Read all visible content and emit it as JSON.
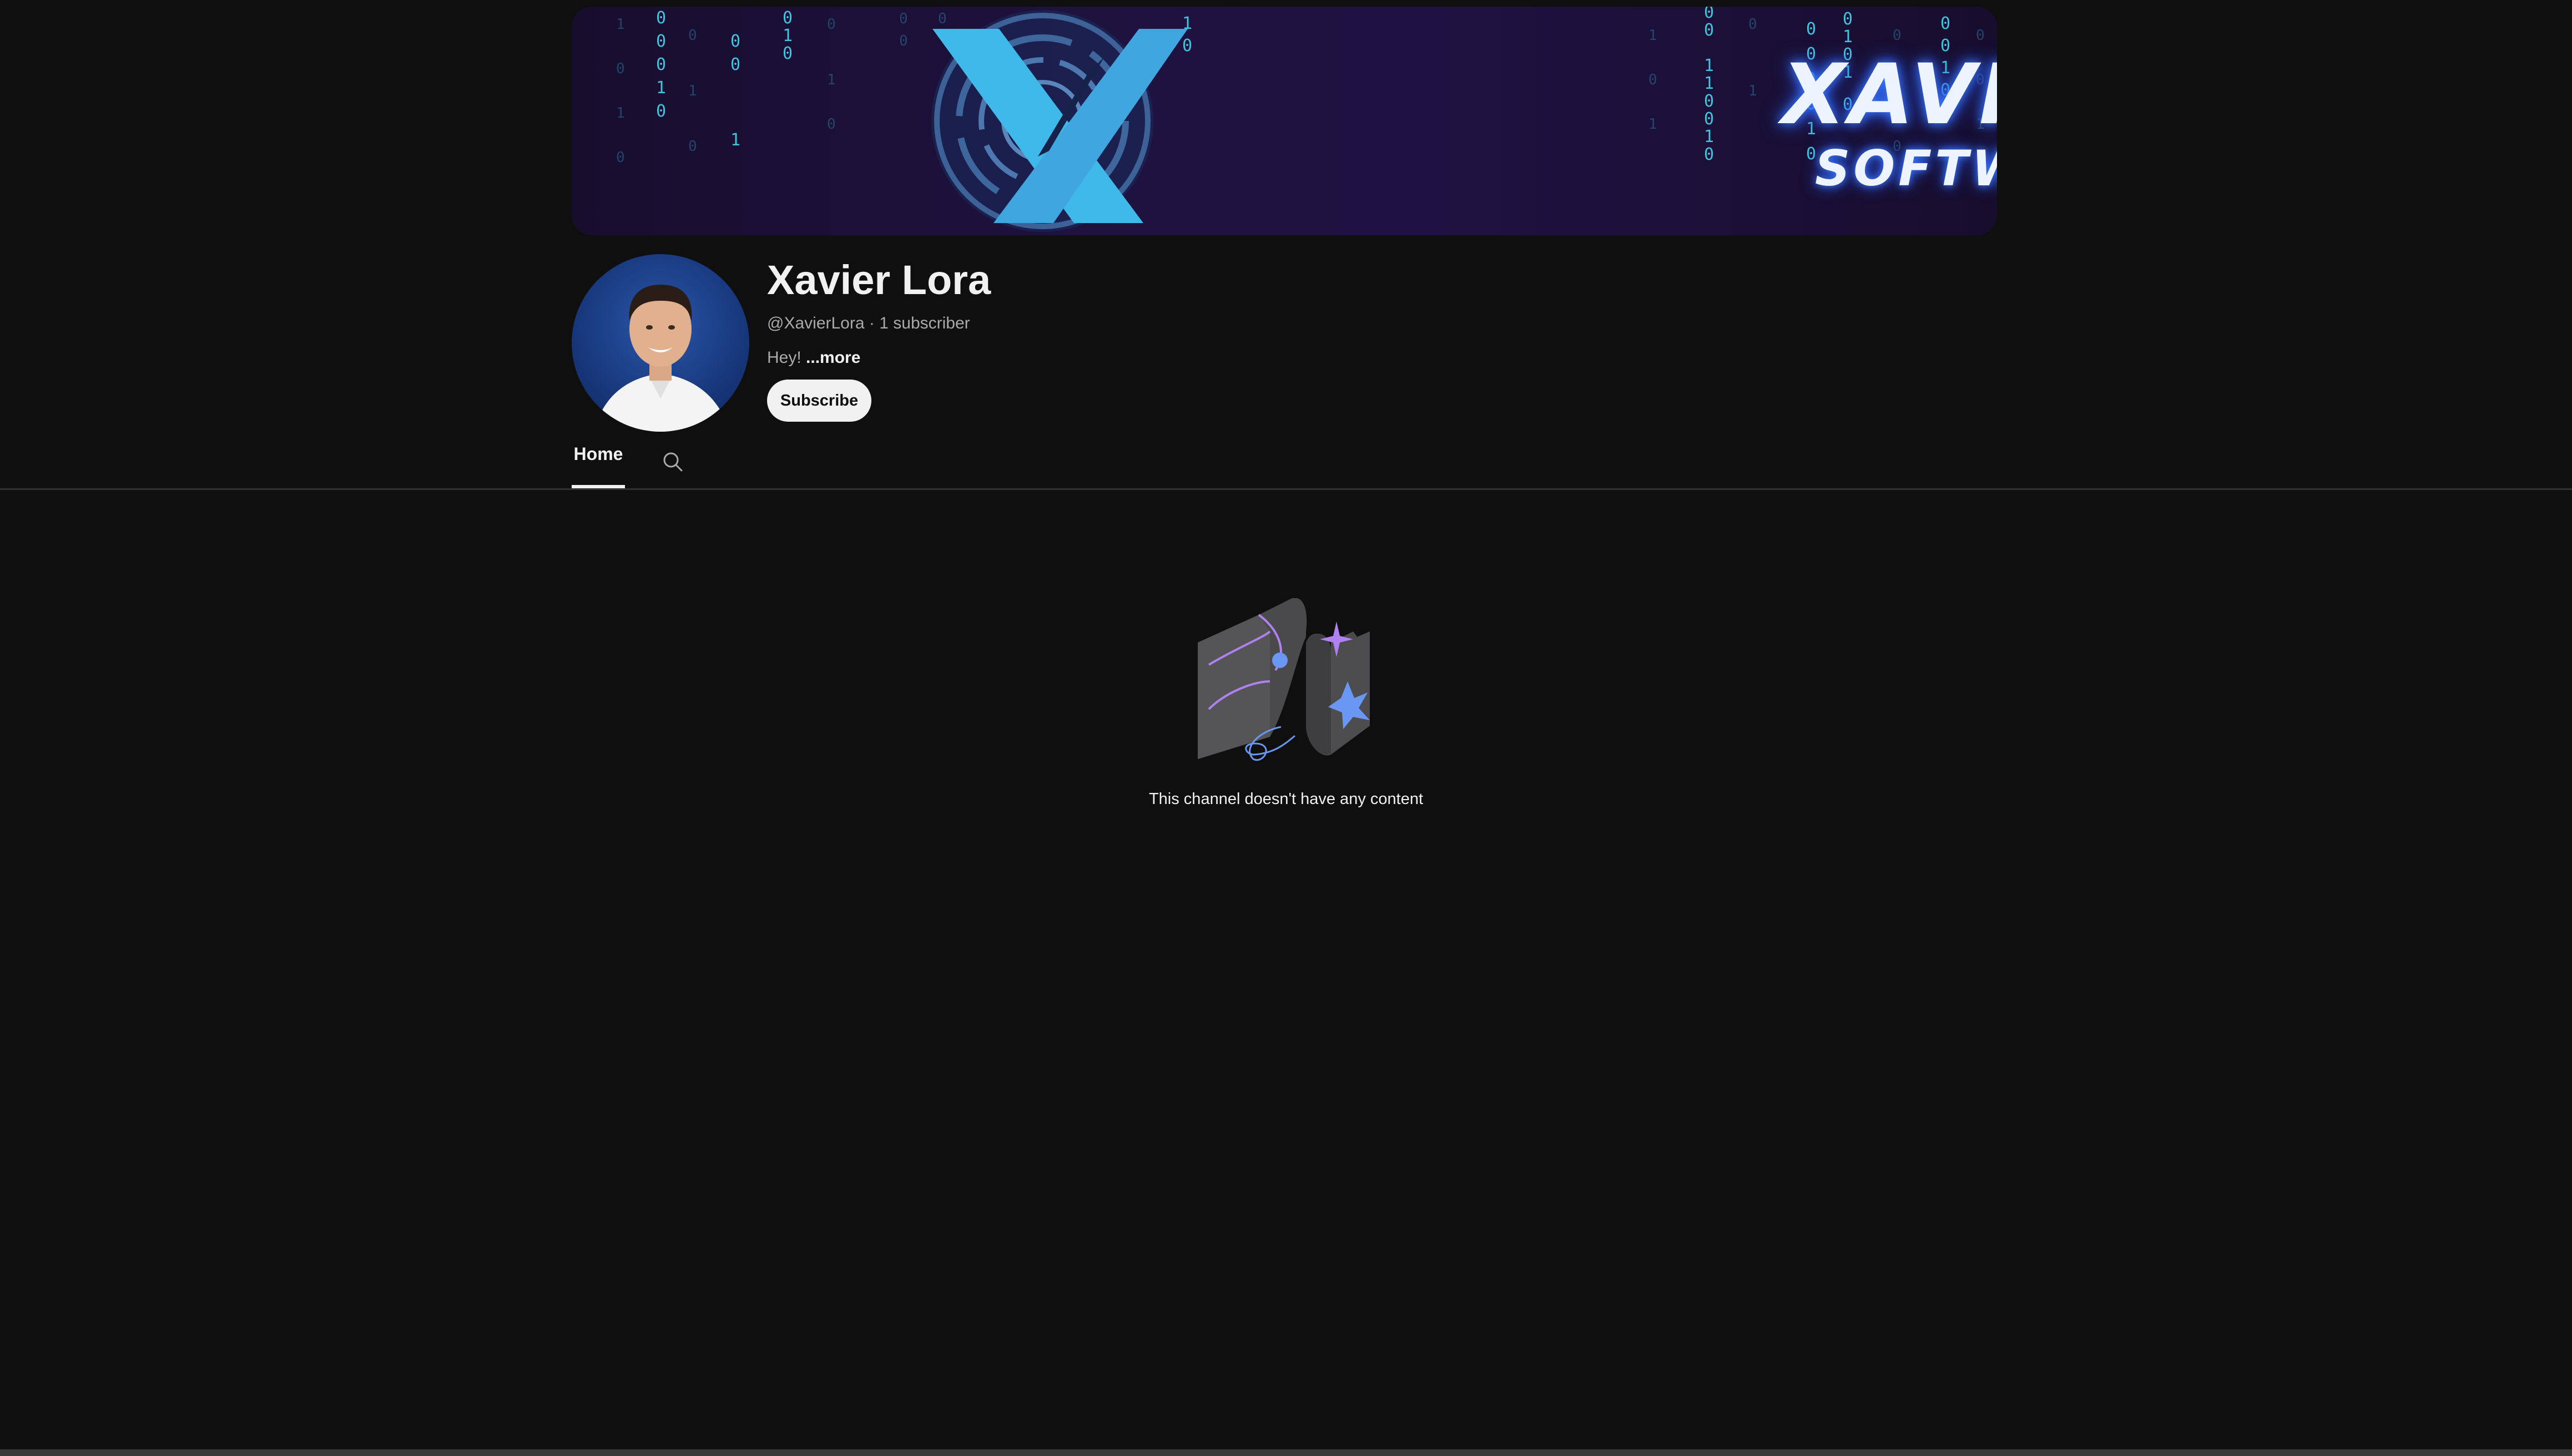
{
  "banner": {
    "title": "XAVIER LORA",
    "subtitle": "SOFTWARE & TECH",
    "logo_letter": "X",
    "accent_color": "#3fb8ea"
  },
  "channel": {
    "name": "Xavier Lora",
    "handle": "@XavierLora",
    "separator": "·",
    "subscribers": "1 subscriber",
    "description": "Hey!",
    "more_label": "...more",
    "subscribe_label": "Subscribe"
  },
  "tabs": {
    "home_label": "Home",
    "search_icon": "search-icon"
  },
  "empty_state": {
    "message": "This channel doesn't have any content",
    "icon": "empty-channel-illustration"
  },
  "colors": {
    "background": "#0f0f0f",
    "text_primary": "#f1f1f1",
    "text_secondary": "#aaaaaa",
    "divider": "#303030",
    "subscribe_bg": "#f1f1f1"
  }
}
